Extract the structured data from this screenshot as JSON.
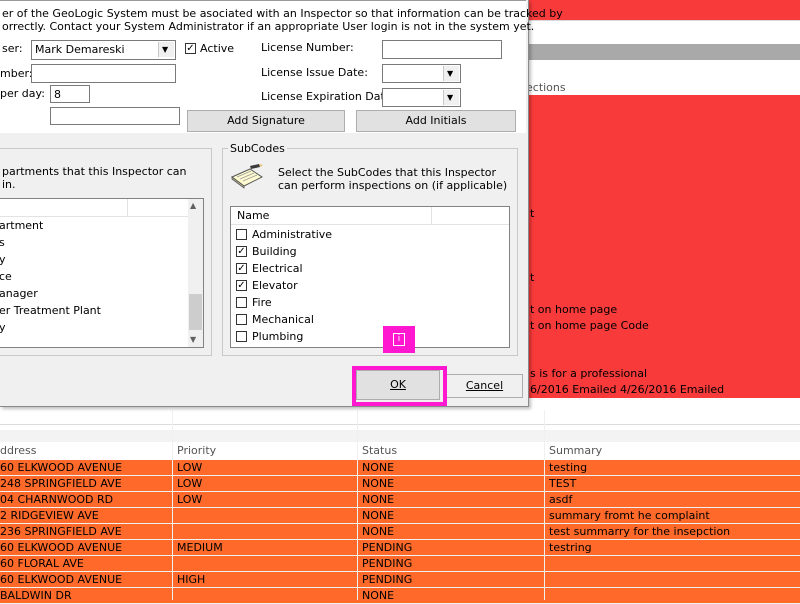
{
  "dialog": {
    "intro_line1": "er of the GeoLogic System must be asociated with an Inspector so that information can be tracked by",
    "intro_line2": "orrectly. Contact your System Administrator if an appropriate User login is not in the system yet.",
    "user_label": "ser:",
    "user_value": "Mark Demareski",
    "active_label": "Active",
    "active_checked": true,
    "number_label": "mber:",
    "per_day_label": " per day:",
    "per_day_value": "8",
    "license_number_label": "License Number:",
    "license_issue_label": "License Issue Date:",
    "license_expiration_label": "License Expiration Date:",
    "add_signature": "Add Signature",
    "add_initials": "Add Initials",
    "departments": {
      "desc_line1": "partments that this Inspector can",
      "desc_line2": "in.",
      "items": [
        "artment",
        "s",
        "y",
        "ce",
        "anager",
        "er Treatment Plant",
        "y"
      ]
    },
    "subcodes": {
      "group_title": "SubCodes",
      "desc_line1": "Select the SubCodes that this Inspector",
      "desc_line2": "can perform inspections on (if applicable)",
      "column": "Name",
      "items": [
        {
          "name": "Administrative",
          "checked": false
        },
        {
          "name": "Building",
          "checked": true
        },
        {
          "name": "Electrical",
          "checked": true
        },
        {
          "name": "Elevator",
          "checked": true
        },
        {
          "name": "Fire",
          "checked": false
        },
        {
          "name": "Mechanical",
          "checked": false
        },
        {
          "name": "Plumbing",
          "checked": false
        }
      ]
    },
    "ok": "OK",
    "cancel": "Cancel"
  },
  "background": {
    "top_header": "ections",
    "red_rows": [
      "t",
      "t",
      "t on home page",
      "t on home page Code",
      "s is for a professional",
      "6/2016 Emailed 4/26/2016 Emailed"
    ],
    "table": {
      "headers": [
        "ddress",
        "Priority",
        "Status",
        "Summary"
      ],
      "rows": [
        [
          "60 ELKWOOD AVENUE",
          "LOW",
          "NONE",
          "testing"
        ],
        [
          "248 SPRINGFIELD AVE",
          "LOW",
          "NONE",
          "TEST"
        ],
        [
          "04 CHARNWOOD RD",
          "LOW",
          "NONE",
          "asdf"
        ],
        [
          "2 RIDGEVIEW AVE",
          "",
          "NONE",
          "summary fromt he complaint"
        ],
        [
          "236 SPRINGFIELD AVE",
          "",
          "NONE",
          "test summarry for the insepction"
        ],
        [
          "60 ELKWOOD AVENUE",
          "MEDIUM",
          "PENDING",
          "testring"
        ],
        [
          "60 FLORAL AVE",
          "",
          "PENDING",
          ""
        ],
        [
          "60 ELKWOOD AVENUE",
          "HIGH",
          "PENDING",
          ""
        ],
        [
          "BALDWIN DR",
          "",
          "NONE",
          ""
        ]
      ]
    }
  },
  "callout_icon": "info-icon",
  "colors": {
    "highlight": "#ff18d0",
    "red_row": "#f93a3a",
    "orange_row": "#ff6a2a"
  }
}
